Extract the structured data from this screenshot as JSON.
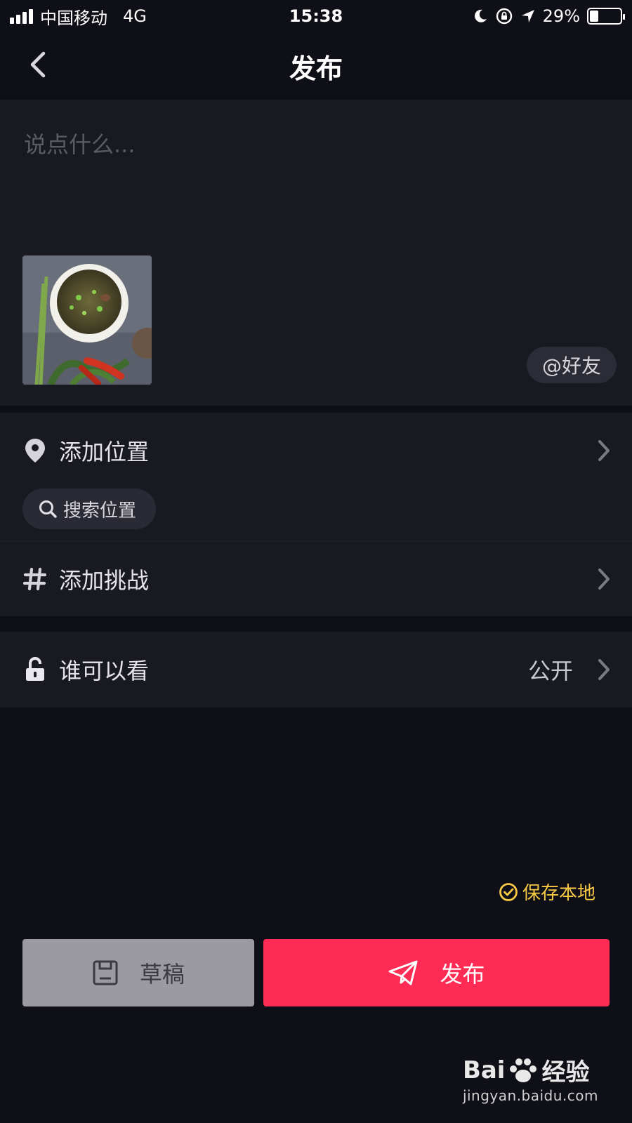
{
  "status_bar": {
    "carrier": "中国移动",
    "network": "4G",
    "time": "15:38",
    "battery": "29%",
    "battery_level": 0.29,
    "icons": [
      "signal-icon",
      "moon-icon",
      "rotation-lock-icon",
      "location-arrow-icon",
      "battery-icon"
    ]
  },
  "nav": {
    "title": "发布",
    "back_icon": "chevron-left-icon"
  },
  "caption": {
    "placeholder": "说点什么...",
    "value": "",
    "mention_label": "@好友"
  },
  "location": {
    "label": "添加位置",
    "search_label": "搜索位置",
    "icon": "location-pin-icon"
  },
  "challenge": {
    "label": "添加挑战",
    "icon": "hashtag-icon"
  },
  "visibility": {
    "label": "谁可以看",
    "value": "公开",
    "icon": "unlock-icon"
  },
  "save_local": {
    "label": "保存本地",
    "checked": true,
    "color": "#f7c944"
  },
  "buttons": {
    "draft_label": "草稿",
    "publish_label": "发布",
    "publish_color": "#fe2c55"
  },
  "watermark": {
    "brand_left": "Bai",
    "brand_right": "经验",
    "url": "jingyan.baidu.com"
  }
}
